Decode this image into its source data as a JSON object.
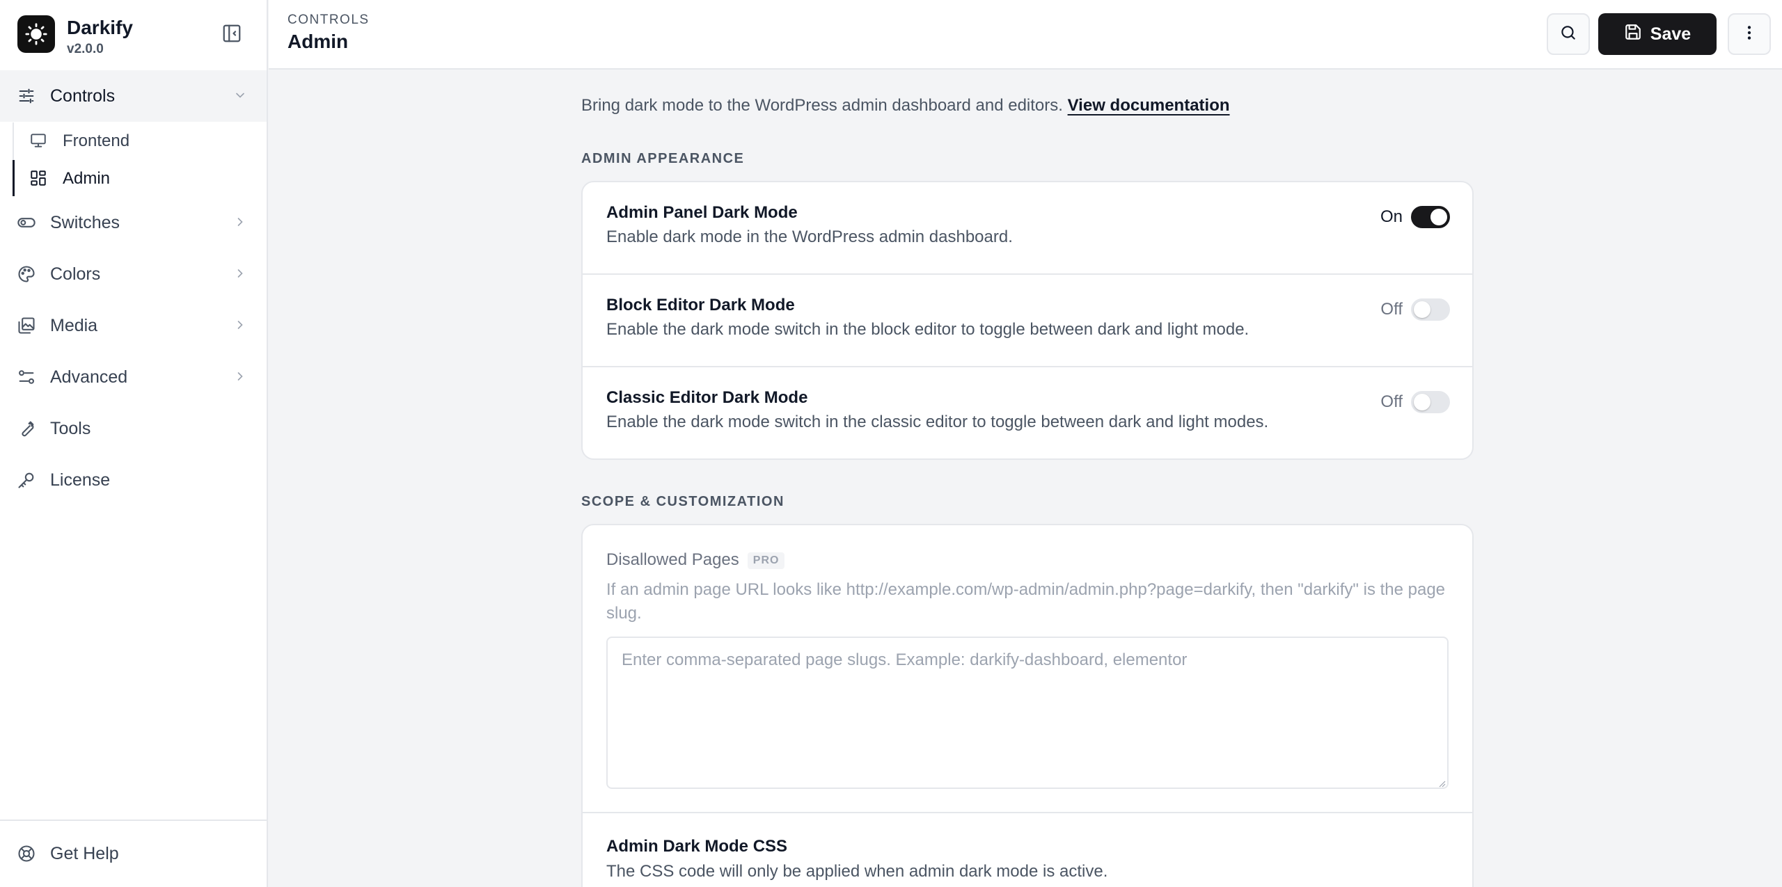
{
  "brand": {
    "name": "Darkify",
    "version": "v2.0.0"
  },
  "sidebar": {
    "items": [
      {
        "label": "Controls",
        "icon": "sliders-icon",
        "expanded": true
      },
      {
        "label": "Switches",
        "icon": "toggle-icon"
      },
      {
        "label": "Colors",
        "icon": "palette-icon"
      },
      {
        "label": "Media",
        "icon": "images-icon"
      },
      {
        "label": "Advanced",
        "icon": "advanced-settings-icon"
      },
      {
        "label": "Tools",
        "icon": "wrench-icon"
      },
      {
        "label": "License",
        "icon": "key-icon"
      }
    ],
    "sub_items": [
      {
        "label": "Frontend",
        "icon": "monitor-icon"
      },
      {
        "label": "Admin",
        "icon": "dashboard-icon",
        "active": true
      }
    ],
    "footer": {
      "label": "Get Help",
      "icon": "lifebuoy-icon"
    }
  },
  "header": {
    "breadcrumb": "CONTROLS",
    "title": "Admin",
    "save_label": "Save"
  },
  "main": {
    "intro_text": "Bring dark mode to the WordPress admin dashboard and editors.",
    "doc_link": "View documentation",
    "sections": [
      {
        "title": "ADMIN APPEARANCE",
        "settings": [
          {
            "title": "Admin Panel Dark Mode",
            "desc": "Enable dark mode in the WordPress admin dashboard.",
            "state": "On"
          },
          {
            "title": "Block Editor Dark Mode",
            "desc": "Enable the dark mode switch in the block editor to toggle between dark and light mode.",
            "state": "Off"
          },
          {
            "title": "Classic Editor Dark Mode",
            "desc": "Enable the dark mode switch in the classic editor to toggle between dark and light modes.",
            "state": "Off"
          }
        ]
      },
      {
        "title": "SCOPE & CUSTOMIZATION",
        "disallowed": {
          "title": "Disallowed Pages",
          "badge": "PRO",
          "desc": "If an admin page URL looks like http://example.com/wp-admin/admin.php?page=darkify, then \"darkify\" is the page slug.",
          "placeholder": "Enter comma-separated page slugs. Example: darkify-dashboard, elementor",
          "value": ""
        },
        "css": {
          "title": "Admin Dark Mode CSS",
          "desc": "The CSS code will only be applied when admin dark mode is active."
        }
      }
    ]
  },
  "colors": {
    "accent": "#18181b",
    "background": "#f3f4f6",
    "border": "#e5e7eb"
  }
}
